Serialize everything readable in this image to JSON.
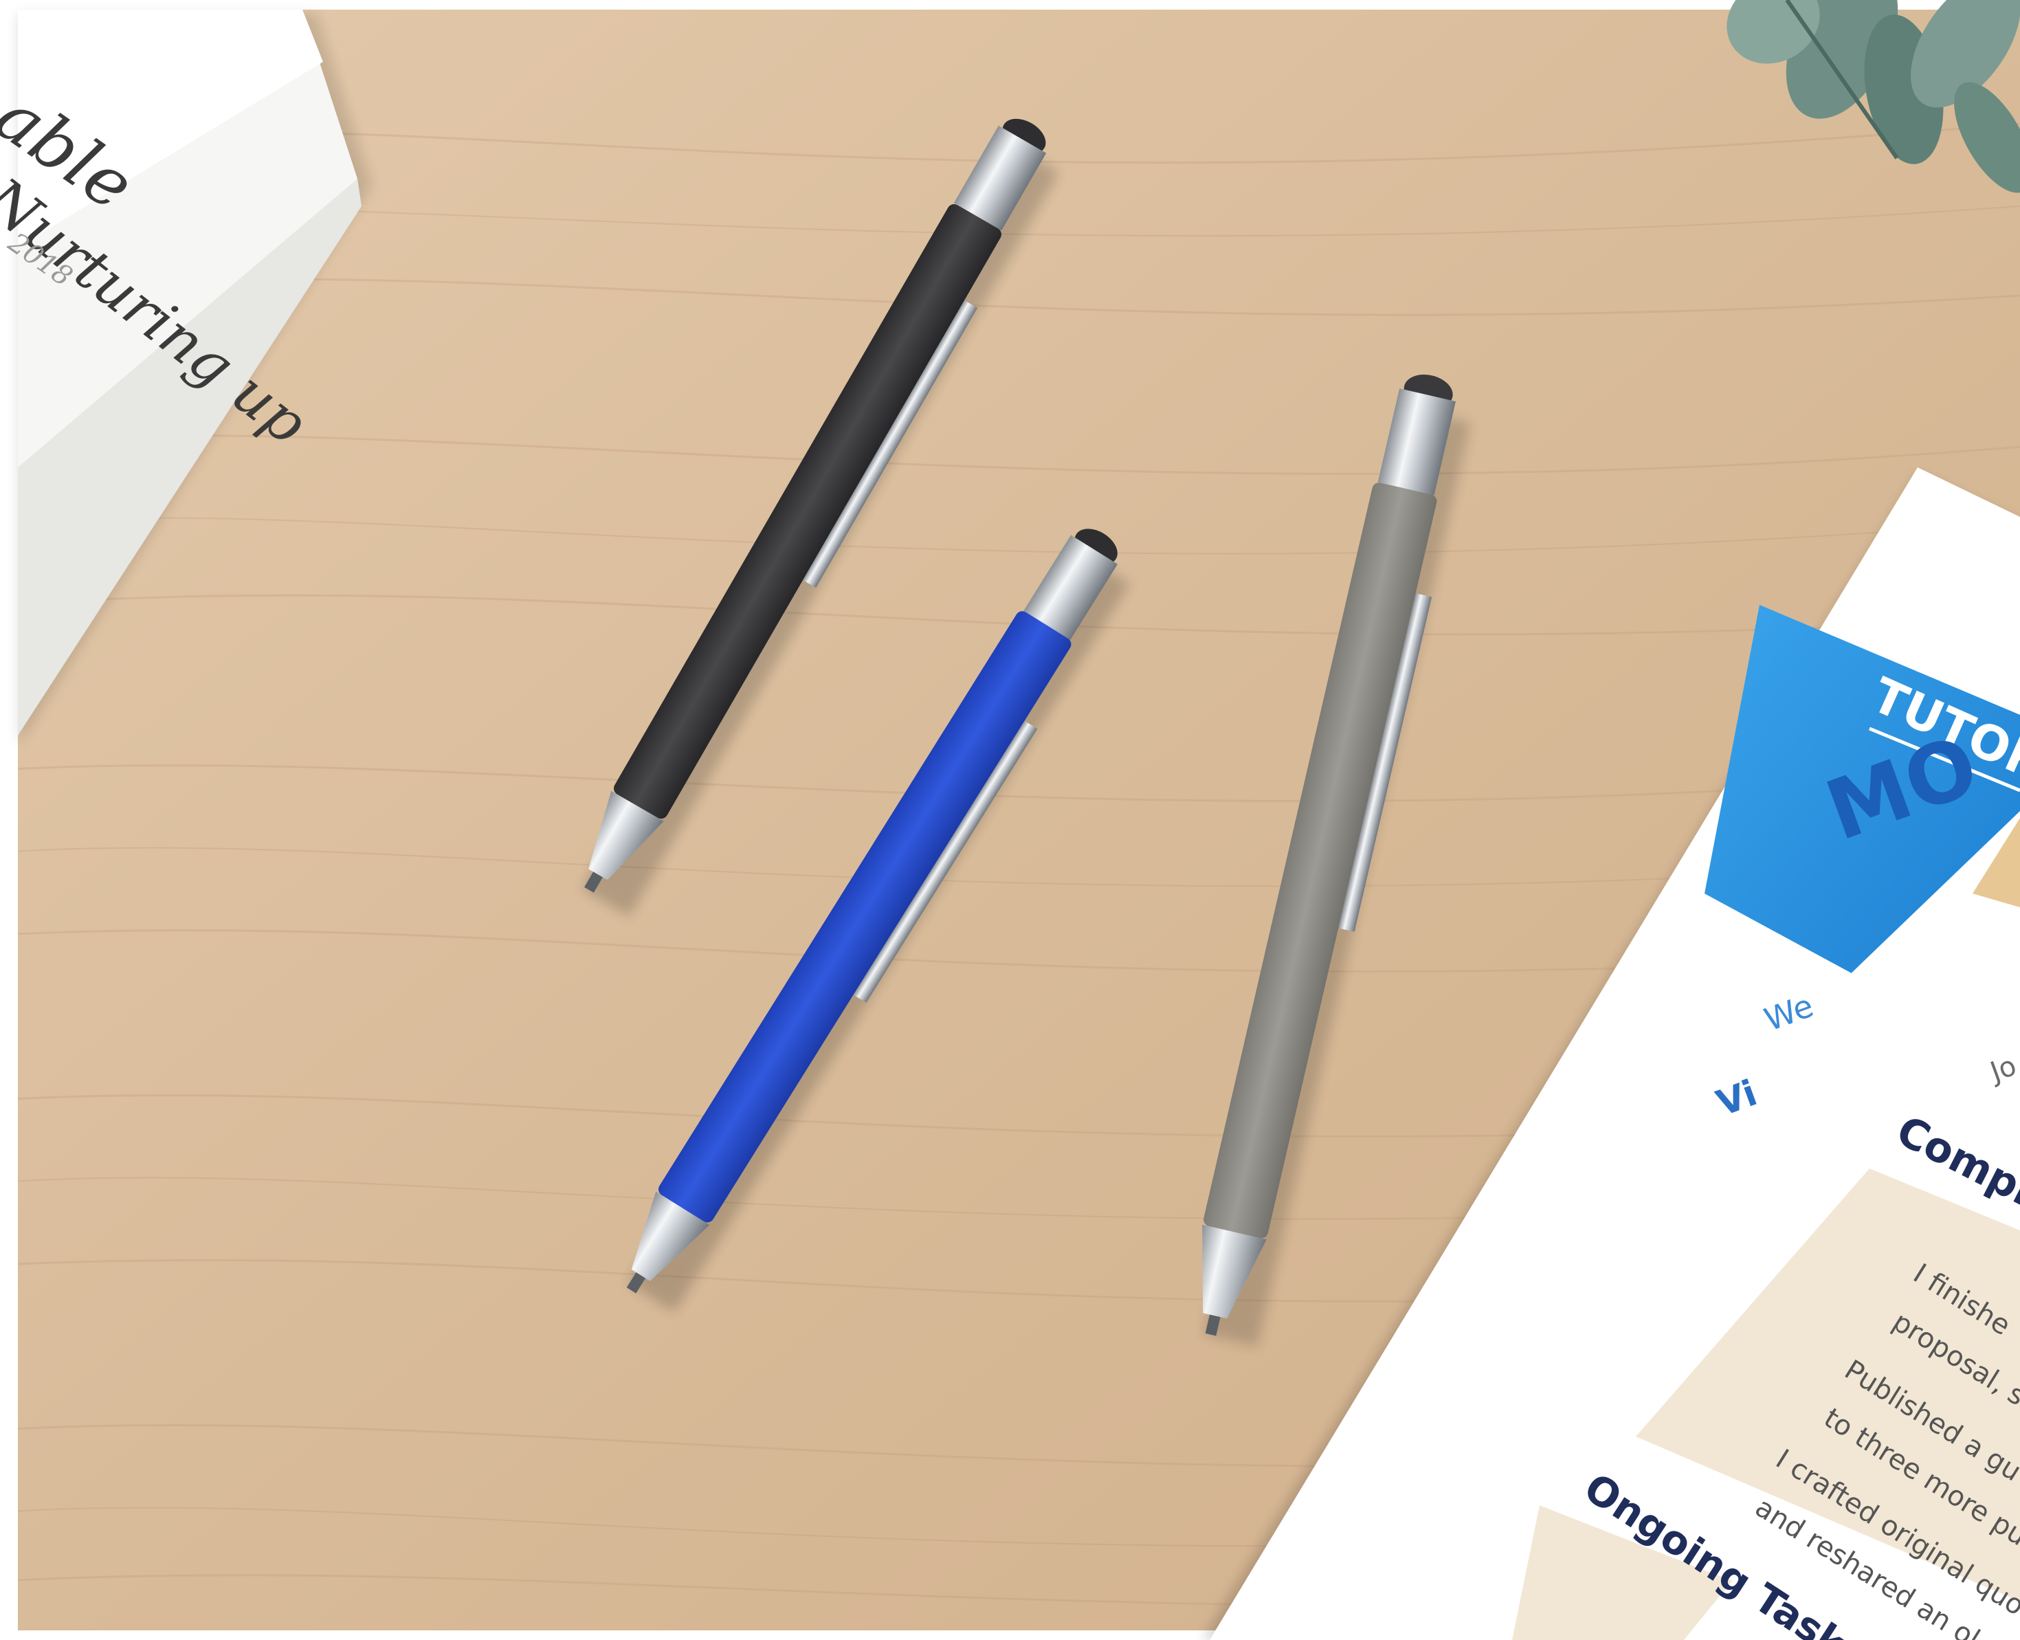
{
  "scene": {
    "description_colors": {
      "wood": "#d9bd9e",
      "wood_dark": "#c7a582",
      "pen_black": "#3a3a3c",
      "pen_blue": "#2a4fd0",
      "pen_gray": "#8d8c86",
      "chrome": "#c9cdd2",
      "paper": "#ffffff",
      "doc_blue": "#2f94e0",
      "doc_panel": "#f3e9d8"
    }
  },
  "notebook": {
    "lines": [
      "able",
      "Nurturing up",
      "2018"
    ]
  },
  "documents": {
    "banner_line1": "TUTORI",
    "banner_line2": "MO",
    "small_blue_1": "We",
    "small_blue_2": "Vi",
    "date_fragment": "Jo",
    "heading_completed": "Comple",
    "bullets": [
      "I finishe",
      "proposal, s",
      "Published a gu",
      "to three more pu",
      "I crafted original quo",
      "and reshared an ol"
    ],
    "heading_ongoing": "Ongoing Task"
  }
}
